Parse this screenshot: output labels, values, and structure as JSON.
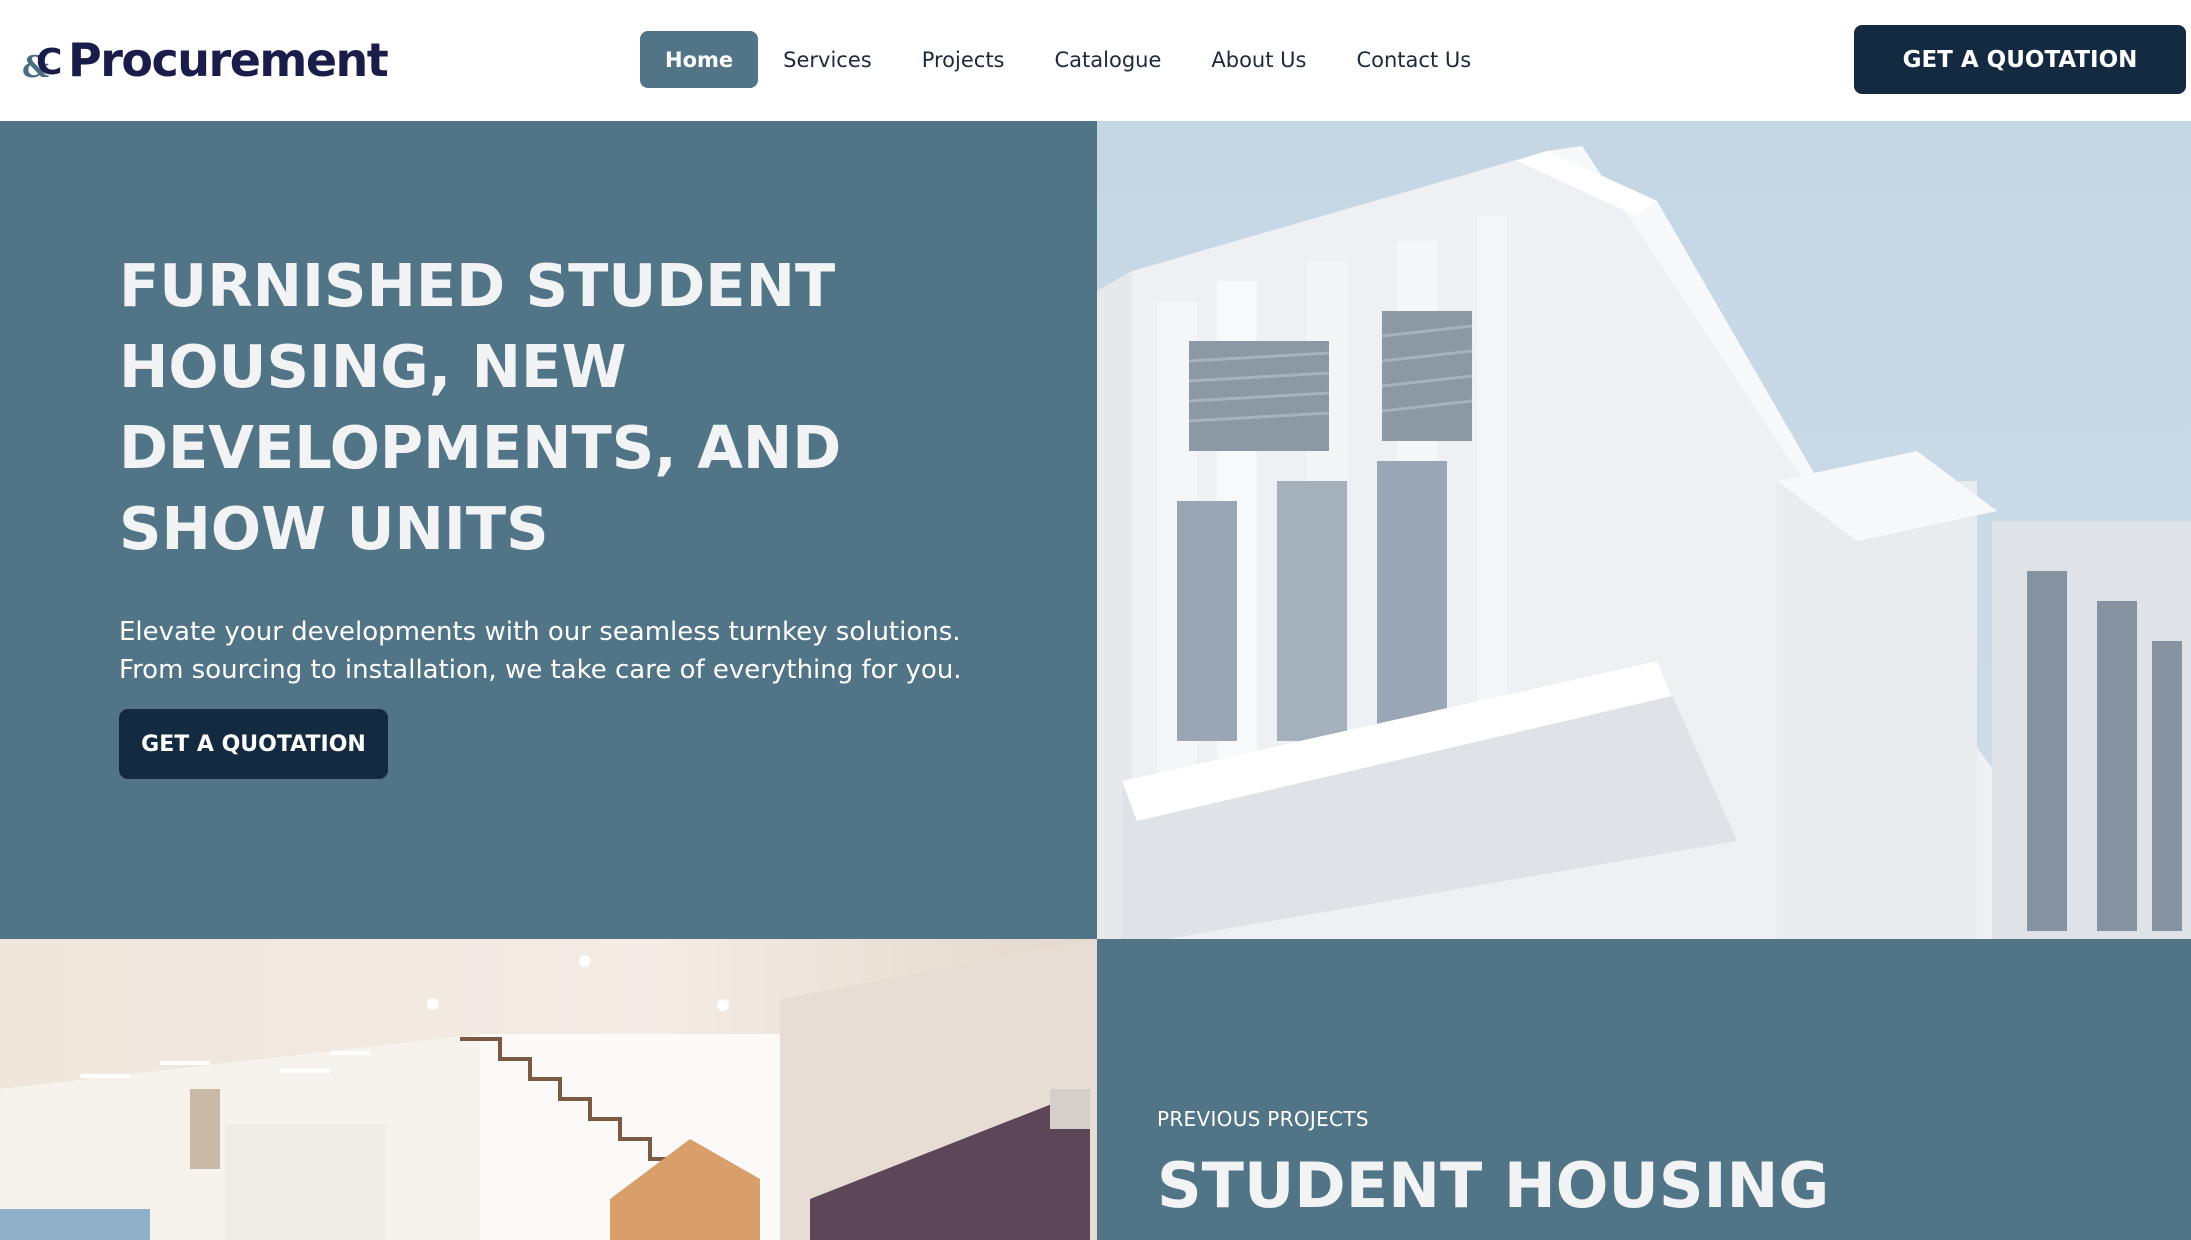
{
  "brand": {
    "logo_mark": "&C",
    "name": "Procurement"
  },
  "nav": {
    "items": [
      {
        "label": "Home",
        "active": true
      },
      {
        "label": "Services",
        "active": false
      },
      {
        "label": "Projects",
        "active": false
      },
      {
        "label": "Catalogue",
        "active": false
      },
      {
        "label": "About Us",
        "active": false
      },
      {
        "label": "Contact Us",
        "active": false
      }
    ]
  },
  "header": {
    "cta_label": "GET A QUOTATION"
  },
  "hero": {
    "title": "FURNISHED STUDENT HOUSING, NEW DEVELOPMENTS, AND SHOW UNITS",
    "description": "Elevate your developments with our seamless turnkey solutions. From sourcing to installation, we take care of everything for you.",
    "cta_label": "GET A QUOTATION",
    "image": "modern-white-apartment-building"
  },
  "projects": {
    "eyebrow": "PREVIOUS PROJECTS",
    "title": "STUDENT HOUSING",
    "image": "furnished-interior-with-staircase"
  },
  "colors": {
    "brand_navy": "#132a41",
    "slate_blue": "#527487",
    "logo_navy": "#1a1d4a",
    "white": "#ffffff"
  }
}
